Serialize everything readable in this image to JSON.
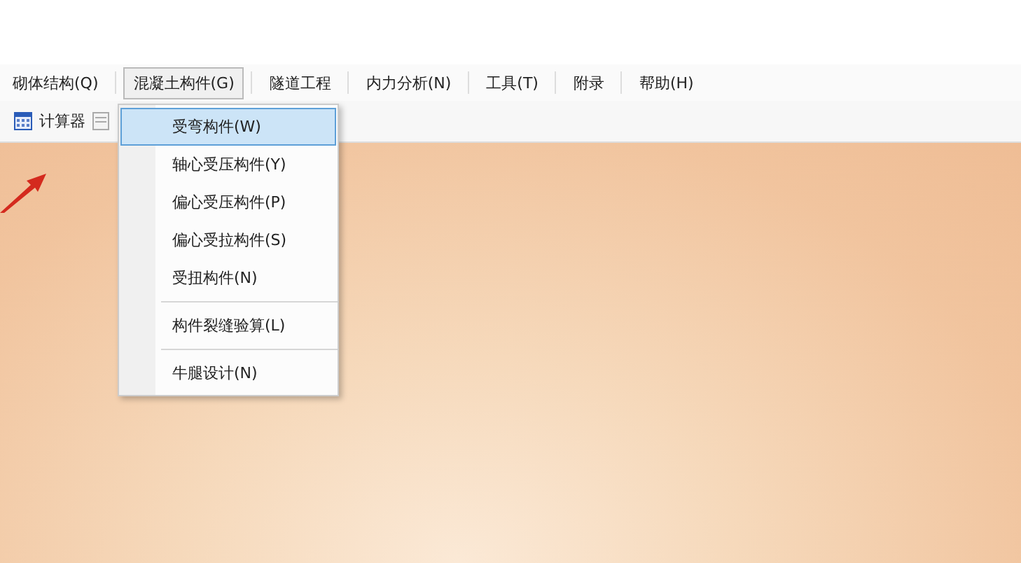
{
  "menu_bar": [
    {
      "label": "砌体结构(Q)",
      "selected": false
    },
    {
      "label": "混凝土构件(G)",
      "selected": true
    },
    {
      "label": "隧道工程",
      "selected": false
    },
    {
      "label": "内力分析(N)",
      "selected": false
    },
    {
      "label": "工具(T)",
      "selected": false
    },
    {
      "label": "附录",
      "selected": false
    },
    {
      "label": "帮助(H)",
      "selected": false
    }
  ],
  "toolbar": [
    {
      "label": "计算器"
    }
  ],
  "dropdown": [
    {
      "kind": "item",
      "label": "受弯构件(W)",
      "selected": true
    },
    {
      "kind": "item",
      "label": "轴心受压构件(Y)",
      "selected": false
    },
    {
      "kind": "item",
      "label": "偏心受压构件(P)",
      "selected": false
    },
    {
      "kind": "item",
      "label": "偏心受拉构件(S)",
      "selected": false
    },
    {
      "kind": "item",
      "label": "受扭构件(N)",
      "selected": false
    },
    {
      "kind": "separator"
    },
    {
      "kind": "item",
      "label": "构件裂缝验算(L)",
      "selected": false
    },
    {
      "kind": "separator"
    },
    {
      "kind": "item",
      "label": "牛腿设计(N)",
      "selected": false
    }
  ]
}
